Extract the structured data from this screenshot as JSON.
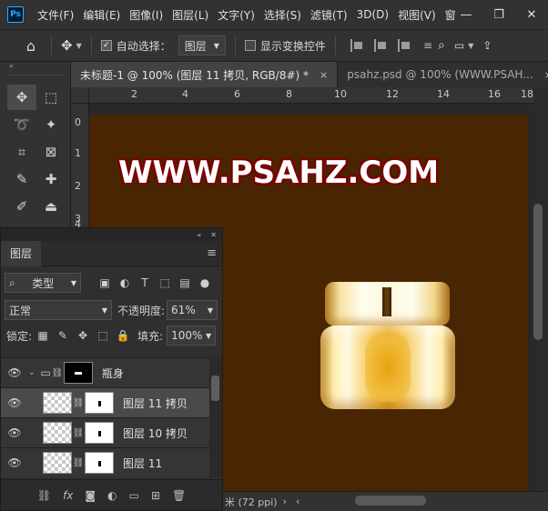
{
  "app": {
    "logo": "Ps"
  },
  "menu": [
    "文件(F)",
    "编辑(E)",
    "图像(I)",
    "图层(L)",
    "文字(Y)",
    "选择(S)",
    "滤镜(T)",
    "3D(D)",
    "视图(V)",
    "窗"
  ],
  "window_controls": {
    "minimize": "—",
    "restore": "❐",
    "close": "✕"
  },
  "options": {
    "auto_select_label": "自动选择：",
    "auto_select_value": "图层",
    "show_transform_label": "显示变换控件"
  },
  "tabs": [
    {
      "label": "未标题-1 @ 100% (图层 11 拷贝, RGB/8#) *",
      "close": "×"
    },
    {
      "label": "psahz.psd @ 100% (WWW.PSAH...",
      "close": "×"
    }
  ],
  "ruler": {
    "top": [
      "2",
      "4",
      "6",
      "8",
      "10",
      "12",
      "14",
      "16",
      "18"
    ],
    "left": [
      "0",
      "1",
      "2",
      "3",
      "4"
    ]
  },
  "canvas": {
    "watermark": "WWW.PSAHZ.COM",
    "background": "#4a2503"
  },
  "status": {
    "text": "米 (72 ppi)"
  },
  "layers_panel": {
    "title": "图层",
    "filter_kind": "类型",
    "blend_mode": "正常",
    "opacity_label": "不透明度:",
    "opacity_value": "61%",
    "lock_label": "锁定:",
    "fill_label": "填充:",
    "fill_value": "100%",
    "layers": [
      {
        "name": "瓶身",
        "type": "group"
      },
      {
        "name": "图层 11 拷贝",
        "type": "layer",
        "selected": true
      },
      {
        "name": "图层 10 拷贝",
        "type": "layer"
      },
      {
        "name": "图层 11",
        "type": "layer"
      }
    ]
  }
}
